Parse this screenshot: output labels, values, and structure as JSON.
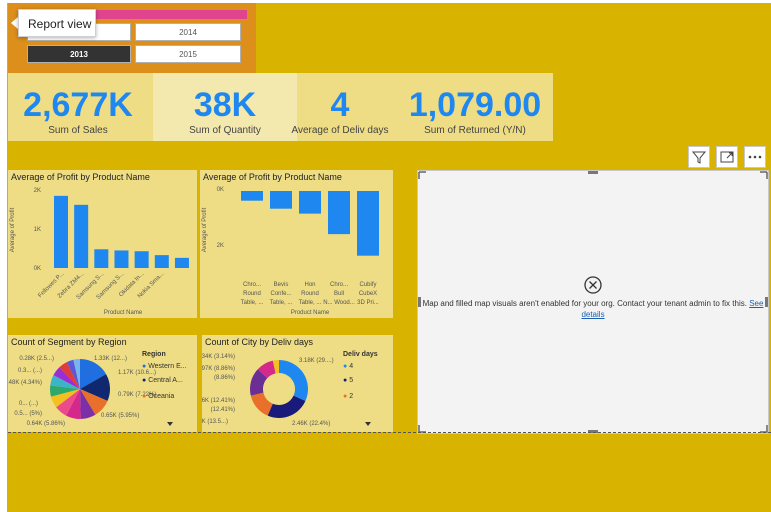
{
  "tooltip": {
    "label": "Report view"
  },
  "slicer": {
    "years": [
      "2014",
      "2013",
      "2015"
    ],
    "selected": "2013",
    "accent": "#e0448f"
  },
  "kpis": [
    {
      "value": "2,677K",
      "label": "Sum of Sales"
    },
    {
      "value": "38K",
      "label": "Sum of Quantity"
    },
    {
      "value": "4",
      "label": "Average of Deliv days"
    },
    {
      "value": "1,079.00",
      "label": "Sum of Returned (Y/N)"
    }
  ],
  "chart1": {
    "title": "Average of Profit by Product Name",
    "ylabel": "Average of Profit",
    "xlabel": "Product Name",
    "ticks": [
      "2K",
      "1K",
      "0K"
    ]
  },
  "chart2": {
    "title": "Average of Profit by Product Name",
    "ylabel": "Average of Profit",
    "xlabel": "Product Name",
    "ticks": [
      "0K",
      "2K"
    ]
  },
  "chart3": {
    "title": "Count of Segment by Region",
    "legend_title": "Region",
    "legend": [
      "Western E...",
      "Central A...",
      "Oceania"
    ],
    "labels": [
      "0.28K (2.5...)",
      "0.3... (...)",
      "0.48K (4.34%)",
      "0... (...)",
      "0.5... (5%)",
      "0.64K (5.86%)",
      "1.33K (12...)",
      "1.17K (10.6...)",
      "0.79K (7.22%)",
      "0.65K (5.95%)"
    ]
  },
  "chart4": {
    "title": "Count of City by Deliv days",
    "legend_title": "Deliv days",
    "legend": [
      "4",
      "5",
      "2"
    ],
    "labels": [
      "0.34K (3.14%)",
      "0.97K (8.86%)",
      "1.56K (12.41%)",
      "1.49K (13.5...)",
      "3.18K (29....)",
      "2.46K (22.4%)"
    ]
  },
  "map": {
    "message": "Map and filled map visuals aren't enabled for your org. Contact your tenant admin to fix this.",
    "link": "See details"
  },
  "chart_data": [
    {
      "type": "bar",
      "title": "Average of Profit by Product Name",
      "xlabel": "Product Name",
      "ylabel": "Average of Profit",
      "categories": [
        "Fellowes P...",
        "Zebra ZM4...",
        "Samsung S...",
        "Samsung S...",
        "Okidata In...",
        "Nokia Sma...",
        ""
      ],
      "values": [
        1850,
        1620,
        480,
        450,
        430,
        330,
        260
      ],
      "ylim": [
        0,
        2000
      ]
    },
    {
      "type": "bar",
      "title": "Average of Profit by Product Name",
      "xlabel": "Product Name",
      "ylabel": "Average of Profit",
      "categories": [
        "Chro... Round Table, ...",
        "Bevis Confe... Table, ...",
        "Hon Round Table, ...",
        "Chro... Bull N... Wood...",
        "Cubify CubeX 3D Pri..."
      ],
      "values": [
        -450,
        -820,
        -1050,
        -2000,
        -3000
      ],
      "ylim": [
        -3200,
        0
      ]
    },
    {
      "type": "pie",
      "title": "Count of Segment by Region",
      "labels": [
        "Western E...",
        "Central A...",
        "Oceania",
        "",
        "",
        "",
        "",
        "",
        "",
        "",
        "",
        "",
        ""
      ],
      "values": [
        1330,
        1170,
        790,
        650,
        640,
        550,
        500,
        480,
        450,
        420,
        380,
        300,
        280
      ],
      "colors": [
        "#1f6fe0",
        "#0f2870",
        "#e8702a",
        "#7d2fa8",
        "#d4288c",
        "#eb4b8b",
        "#f4c020",
        "#2fa86e",
        "#3cb4c8",
        "#9a2dd8",
        "#e23b3b",
        "#5a5ad8",
        "#7ab4f0"
      ]
    },
    {
      "type": "pie",
      "title": "Count of City by Deliv days",
      "labels": [
        "4",
        "5",
        "2",
        "",
        "",
        ""
      ],
      "values": [
        3180,
        2460,
        1490,
        1560,
        970,
        340
      ],
      "colors": [
        "#1e88f0",
        "#1a1a7a",
        "#e8702a",
        "#6b2e94",
        "#d4288c",
        "#f4c020"
      ]
    }
  ]
}
